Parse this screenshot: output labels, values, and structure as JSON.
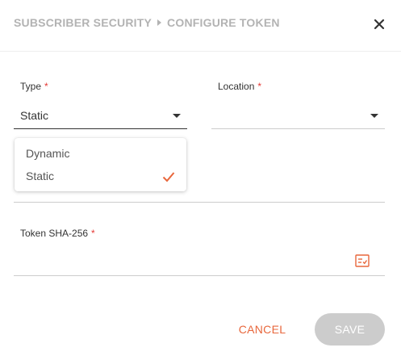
{
  "breadcrumb": {
    "parent": "SUBSCRIBER SECURITY",
    "current": "CONFIGURE TOKEN"
  },
  "close_icon": "close-icon",
  "type_field": {
    "label": "Type",
    "required_mark": "*",
    "value": "Static"
  },
  "location_field": {
    "label": "Location",
    "required_mark": "*",
    "value": ""
  },
  "type_options": [
    {
      "label": "Dynamic",
      "selected": false
    },
    {
      "label": "Static",
      "selected": true
    }
  ],
  "token_field": {
    "label": "Token SHA-256",
    "required_mark": "*",
    "value": "",
    "icon": "token-list-icon"
  },
  "footer": {
    "cancel_label": "CANCEL",
    "save_label": "SAVE"
  },
  "colors": {
    "accent": "#e8673c",
    "save_disabled": "#cccccc",
    "required": "#e53935",
    "muted": "#b3b3b3"
  }
}
